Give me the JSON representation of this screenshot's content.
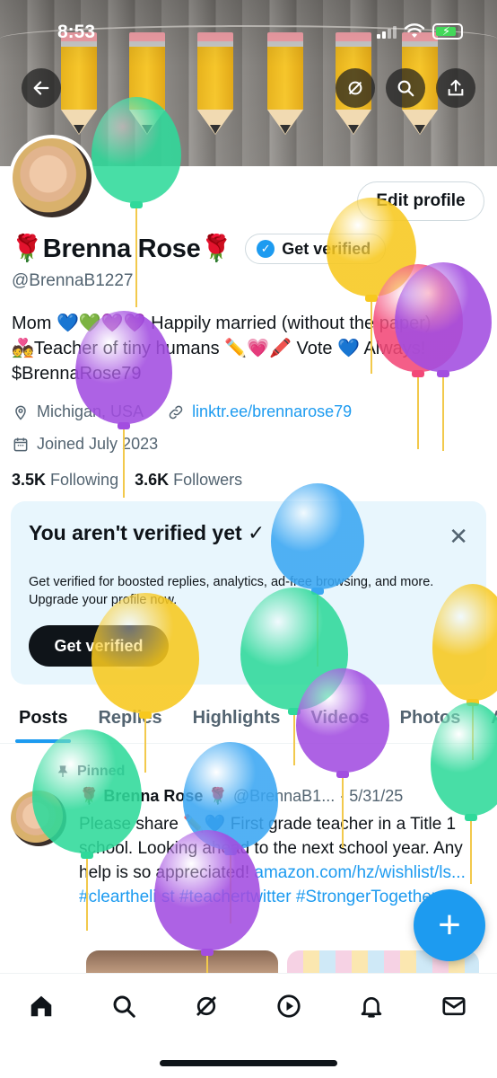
{
  "status_bar": {
    "time": "8:53"
  },
  "header": {
    "back_icon": "arrow-left-icon",
    "grok_icon": "grok-icon",
    "search_icon": "search-icon",
    "share_icon": "share-icon"
  },
  "profile": {
    "display_name": "🌹Brenna Rose🌹",
    "handle": "@BrennaB1227",
    "edit_button": "Edit profile",
    "get_verified_pill": "Get verified",
    "bio_lines": [
      "Mom 💙💚💜💜 Happily married (without the paper)",
      "💑Teacher of tiny humans ✏️💗🖍️ Vote 💙 Always!",
      "$BrennaRose79"
    ],
    "location": "Michigan, USA",
    "link": "linktr.ee/brennarose79",
    "joined": "Joined July 2023",
    "following_count": "3.5K",
    "following_label": "Following",
    "followers_count": "3.6K",
    "followers_label": "Followers"
  },
  "verify_card": {
    "title": "You aren't verified yet ✓",
    "body": "Get verified for boosted replies, analytics, ad-free browsing, and more. Upgrade your profile now.",
    "button": "Get verified",
    "close_symbol": "✕"
  },
  "tabs": [
    "Posts",
    "Replies",
    "Highlights",
    "Videos",
    "Photos",
    "Ar"
  ],
  "post": {
    "pinned_label": "Pinned",
    "author": "🌹 Brenna Rose 🌹",
    "handle_date": "@BrennaB1... · 5/31/25",
    "text_1": "Please share ✏️💙 First grade teacher in a Title 1 school. Looking ahead to the next school year. Any help is so appreciated! ",
    "link_1": "amazon.com/hz/wishlist/ls...",
    "hashtags": " #cleartheli st #teachertwitter #StrongerTogether"
  },
  "fab": {
    "symbol": "+"
  },
  "bottom_nav": [
    "home-icon",
    "search-icon",
    "grok-icon",
    "play-icon",
    "bell-icon",
    "mail-icon"
  ],
  "colors": {
    "accent": "#1d9bf0",
    "text_primary": "#0f1419",
    "text_secondary": "#536471",
    "verify_card_bg": "#e8f6fd",
    "balloon_green": "#2fd99a",
    "balloon_purple": "#a24de0",
    "balloon_yellow": "#f7c81e",
    "balloon_blue": "#3aa6f2",
    "balloon_pink": "#f24878"
  }
}
